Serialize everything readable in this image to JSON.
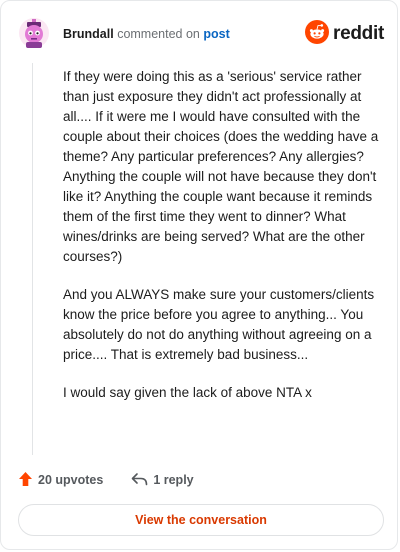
{
  "header": {
    "username": "Brundall",
    "action_text": "commented on",
    "post_link": "post",
    "brand_name": "reddit"
  },
  "comment": {
    "paragraphs": [
      "If they were doing this as a 'serious' service rather than just exposure they didn't act professionally at all.... If it were me I would have consulted with the couple about their choices (does the wedding have a theme? Any particular preferences? Any allergies? Anything the couple will not have because they don't like it? Anything the couple want because it reminds them of the first time they went to dinner? What wines/drinks are being served? What are the other courses?)",
      "And you ALWAYS make sure your customers/clients know the price before you agree to anything... You absolutely do not do anything without agreeing on a price.... That is extremely bad business...",
      "I would say given the lack of above NTA x"
    ]
  },
  "footer": {
    "upvotes_label": "20 upvotes",
    "replies_label": "1 reply",
    "view_conversation_label": "View the conversation"
  },
  "colors": {
    "accent": "#d93900",
    "reddit_orange": "#ff4500",
    "link_blue": "#0a66c2",
    "text": "#1c1c1c",
    "muted": "#6b6f73"
  },
  "icons": {
    "avatar": "user-avatar-icon",
    "brand": "reddit-logo-icon",
    "upvote": "upvote-arrow-icon",
    "reply": "reply-arrow-icon"
  }
}
